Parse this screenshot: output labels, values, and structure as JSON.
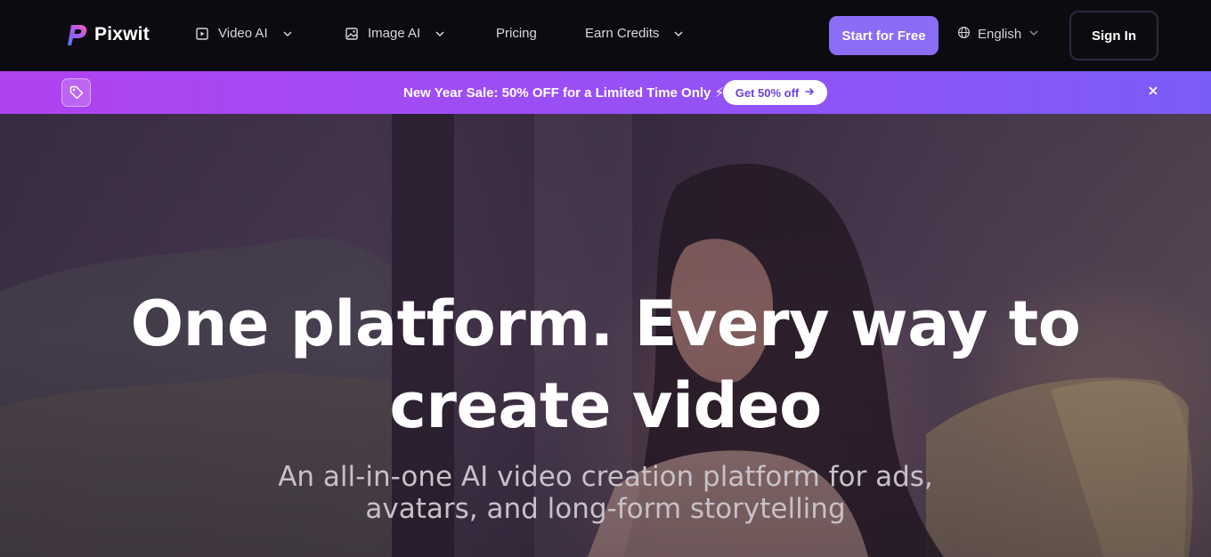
{
  "brand": {
    "name": "Pixwit",
    "logo_icon": "pixwit-logo-icon"
  },
  "nav": {
    "items": [
      {
        "label": "Video AI",
        "icon": "video-play-icon",
        "has_dropdown": true
      },
      {
        "label": "Image AI",
        "icon": "image-icon",
        "has_dropdown": true
      },
      {
        "label": "Pricing",
        "has_dropdown": false
      },
      {
        "label": "Earn Credits",
        "has_dropdown": true
      }
    ],
    "start_button": "Start for Free",
    "language": "English",
    "sign_in": "Sign In"
  },
  "banner": {
    "text": "New Year Sale: 50% OFF for a Limited Time Only ⚡",
    "cta": "Get 50% off",
    "icon": "price-tag-icon"
  },
  "hero": {
    "title_line1": "One platform. Every way to",
    "title_line2": "create video",
    "subtitle_line1": "An all-in-one AI video creation platform for ads,",
    "subtitle_line2": "avatars, and long-form storytelling"
  },
  "colors": {
    "accent": "#8a6cf7",
    "banner_start": "#b142f0",
    "banner_end": "#7c5cf8",
    "nav_bg": "#0c0c10"
  }
}
